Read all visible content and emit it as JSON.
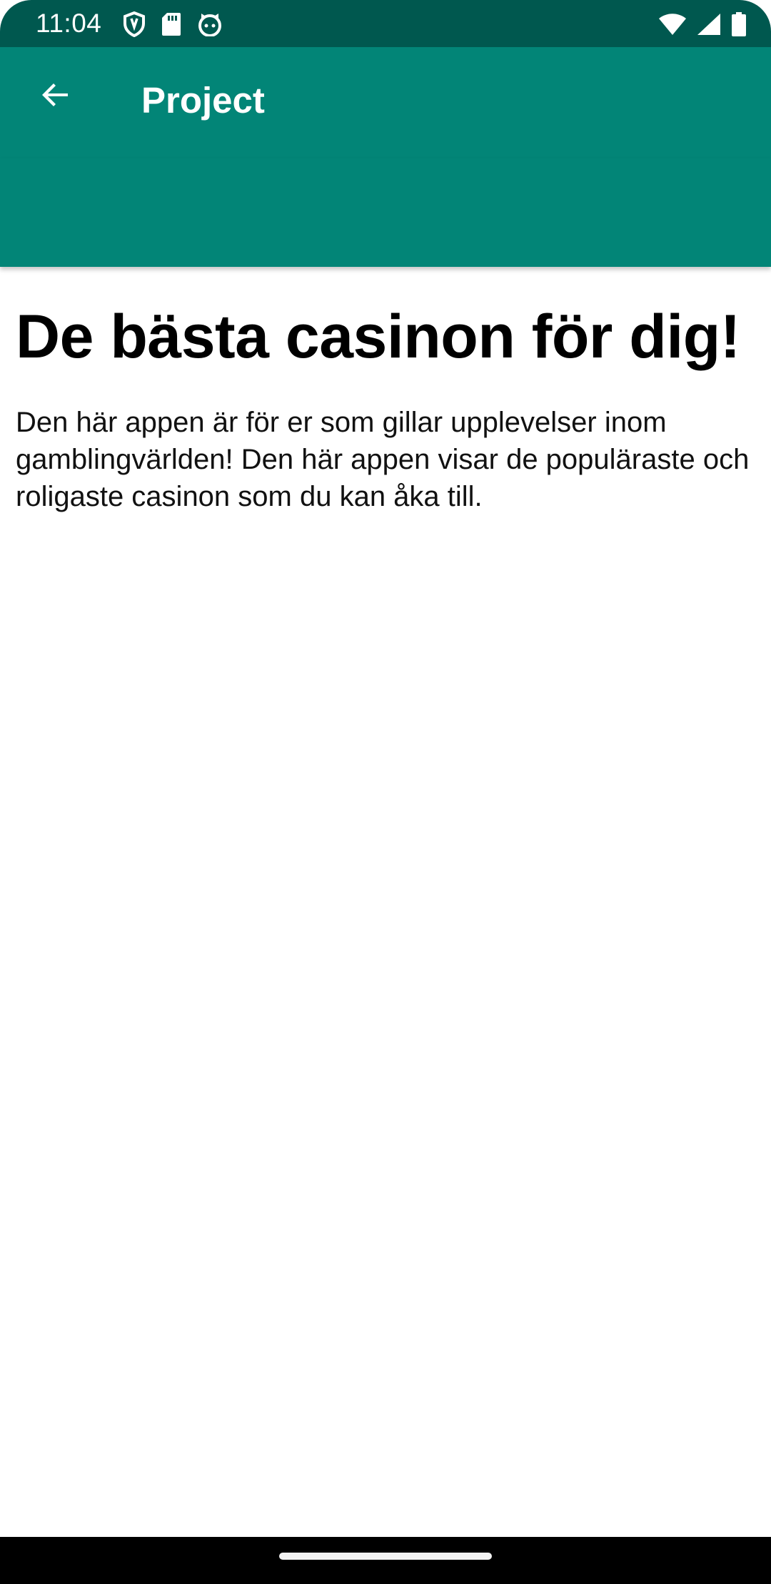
{
  "status_bar": {
    "time": "11:04",
    "icons_left": [
      "shield-icon",
      "sd-card-icon",
      "cat-face-icon"
    ],
    "icons_right": [
      "wifi-icon",
      "cellular-signal-icon",
      "battery-icon"
    ],
    "background": "#00584F"
  },
  "app_bar": {
    "back_icon": "arrow-back-icon",
    "title": "Project",
    "background": "#028577"
  },
  "content": {
    "heading": "De bästa casinon för dig!",
    "body": "Den här appen är för er som gillar upplevelser inom gamblingvärlden! Den här appen visar de populäraste och roligaste casinon som du kan åka till."
  },
  "navigation_bar": {
    "home_indicator": "home-indicator",
    "background": "#000000"
  }
}
